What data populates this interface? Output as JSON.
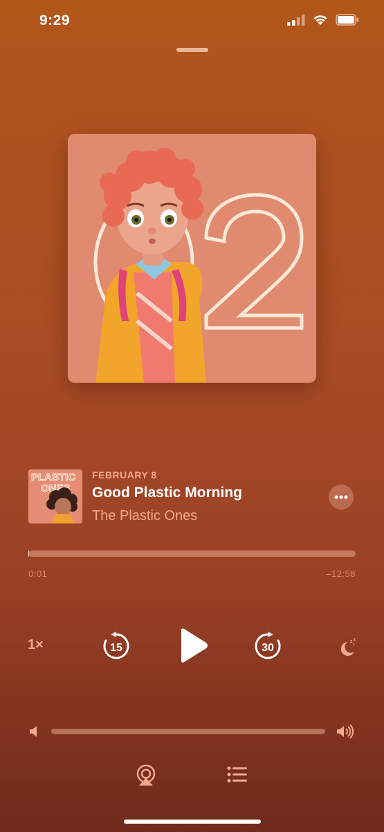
{
  "status_bar": {
    "time": "9:29",
    "icons": [
      "cellular-signal-icon",
      "wifi-icon",
      "battery-icon"
    ]
  },
  "artwork": {
    "description_icon": "podcast-cover-art",
    "number": "02"
  },
  "episode": {
    "date": "FEBRUARY 8",
    "title": "Good Plastic Morning",
    "show": "The Plastic Ones",
    "thumbnail_text_line1": "PLASTIC",
    "thumbnail_text_line2": "ONES"
  },
  "playback": {
    "progress_fraction": 0.001,
    "elapsed": "0:01",
    "remaining": "‒12:58",
    "speed": "1×",
    "skip_back_seconds": "15",
    "skip_forward_seconds": "30"
  },
  "volume": {
    "level_fraction": 0.0
  },
  "colors": {
    "accent": "#f7a98d",
    "background_top": "#b2561a",
    "background_bottom": "#6e2a1a",
    "artwork_bg": "#e08a70"
  }
}
